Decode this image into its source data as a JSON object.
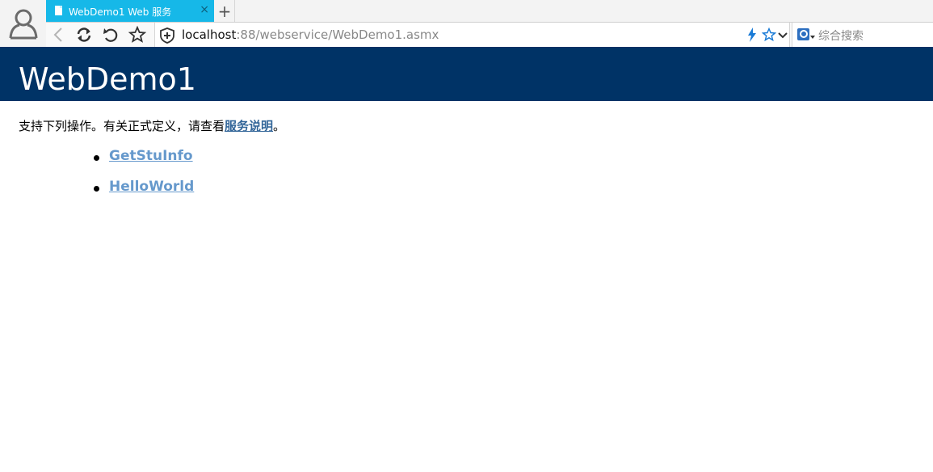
{
  "browser": {
    "tab": {
      "title": "WebDemo1 Web 服务",
      "close": "×"
    },
    "new_tab": "+",
    "address": {
      "host": "localhost",
      "rest": ":88/webservice/WebDemo1.asmx"
    },
    "search": {
      "placeholder": "综合搜索"
    },
    "colors": {
      "tab_active": "#16b8e8"
    }
  },
  "page": {
    "title": "WebDemo1",
    "intro_text": "支持下列操作。有关正式定义，请查看",
    "intro_link": "服务说明",
    "intro_end": "。",
    "operations": [
      "GetStuInfo",
      "HelloWorld"
    ],
    "colors": {
      "header_bg": "#003366",
      "link": "#6699cc"
    }
  }
}
